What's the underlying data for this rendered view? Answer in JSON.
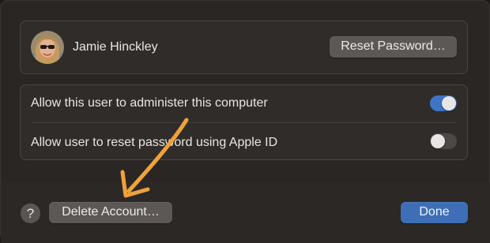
{
  "user": {
    "name": "Jamie Hinckley",
    "reset_password_label": "Reset Password…"
  },
  "options": [
    {
      "label": "Allow this user to administer this computer",
      "enabled": true
    },
    {
      "label": "Allow user to reset password using Apple ID",
      "enabled": false
    }
  ],
  "footer": {
    "help_label": "?",
    "delete_label": "Delete Account…",
    "done_label": "Done"
  },
  "colors": {
    "accent": "#3e6fb6",
    "toggle_on": "#3f74c7",
    "annotation_arrow": "#f0a23a"
  }
}
